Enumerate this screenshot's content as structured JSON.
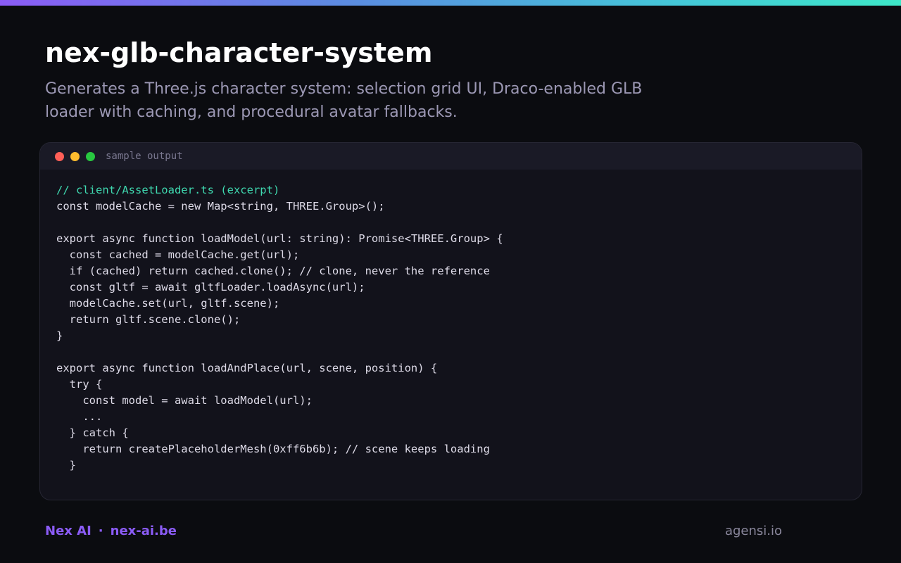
{
  "header": {
    "title": "nex-glb-character-system",
    "subtitle": "Generates a Three.js character system: selection grid UI, Draco-enabled GLB loader with caching, and procedural avatar fallbacks."
  },
  "code_card": {
    "label": "sample output",
    "lines": [
      "// client/AssetLoader.ts (excerpt)",
      "const modelCache = new Map<string, THREE.Group>();",
      "",
      "export async function loadModel(url: string): Promise<THREE.Group> {",
      "  const cached = modelCache.get(url);",
      "  if (cached) return cached.clone(); // clone, never the reference",
      "  const gltf = await gltfLoader.loadAsync(url);",
      "  modelCache.set(url, gltf.scene);",
      "  return gltf.scene.clone();",
      "}",
      "",
      "export async function loadAndPlace(url, scene, position) {",
      "  try {",
      "    const model = await loadModel(url);",
      "    ...",
      "  } catch {",
      "    return createPlaceholderMesh(0xff6b6b); // scene keeps loading",
      "  }"
    ]
  },
  "footer": {
    "brand": "Nex AI",
    "separator": "·",
    "link": "nex-ai.be",
    "right": "agensi.io"
  },
  "colors": {
    "background": "#0b0c10",
    "accent": "#8b5cf6",
    "comment": "#3fd9b0",
    "dot_red": "#ff5f57",
    "dot_yellow": "#febc2e",
    "dot_green": "#28c840"
  }
}
